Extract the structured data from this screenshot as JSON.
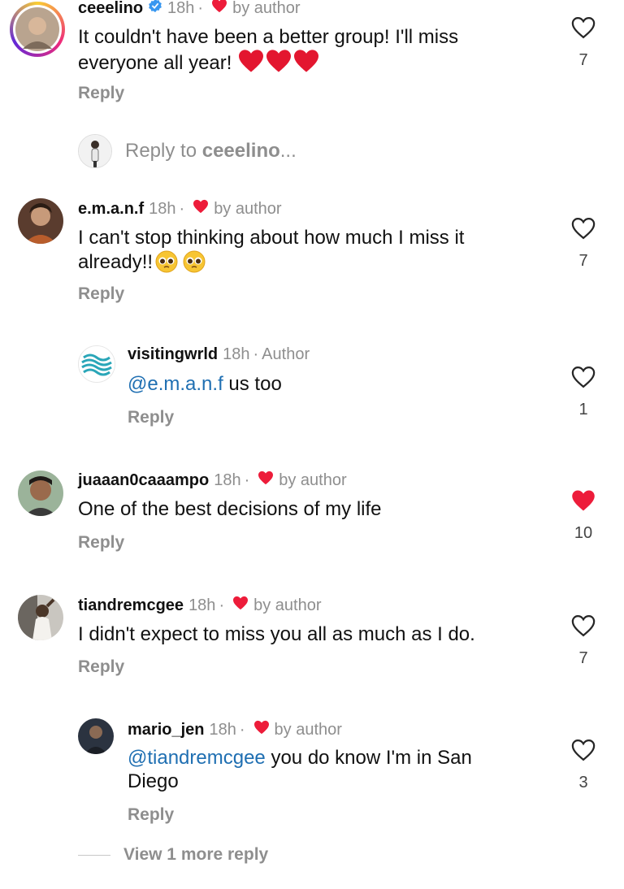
{
  "comments": [
    {
      "username": "ceeelino",
      "verified": true,
      "time": "18h",
      "sep": "·",
      "author_badge": "by author",
      "text": "It couldn't have been a better group! I'll miss everyone all year!",
      "reply_label": "Reply",
      "likes": "7",
      "liked": false
    },
    {
      "username": "e.m.a.n.f",
      "time": "18h",
      "sep": "·",
      "author_badge": "by author",
      "text_line1": "I can't stop thinking about how much I miss it",
      "text_line2": "already!!",
      "reply_label": "Reply",
      "likes": "7",
      "liked": false
    },
    {
      "username": "visitingwrld",
      "time": "18h",
      "sep": "·",
      "author_badge": "Author",
      "mention": "@e.m.a.n.f",
      "text": " us too",
      "reply_label": "Reply",
      "likes": "1",
      "liked": false
    },
    {
      "username": "juaaan0caaampo",
      "time": "18h",
      "sep": "·",
      "author_badge": "by author",
      "text": "One of the best decisions of my life",
      "reply_label": "Reply",
      "likes": "10",
      "liked": true
    },
    {
      "username": "tiandremcgee",
      "time": "18h",
      "sep": "·",
      "author_badge": "by author",
      "text": "I didn't expect to miss you all as much as I do.",
      "reply_label": "Reply",
      "likes": "7",
      "liked": false
    },
    {
      "username": "mario_jen",
      "time": "18h",
      "sep": "·",
      "author_badge": "by author",
      "mention": "@tiandremcgee",
      "text_line1": " you do know I'm in San",
      "text_line2": "Diego",
      "reply_label": "Reply",
      "likes": "3",
      "liked": false
    }
  ],
  "reply_to": {
    "prefix": "Reply to ",
    "username": "ceeelino",
    "suffix": "..."
  },
  "view_more": "View 1 more reply",
  "colors": {
    "heart_red": "#ed1c3a",
    "mention_blue": "#1f6fb2",
    "muted": "#8e8e8e",
    "verified_blue": "#3897f0"
  }
}
